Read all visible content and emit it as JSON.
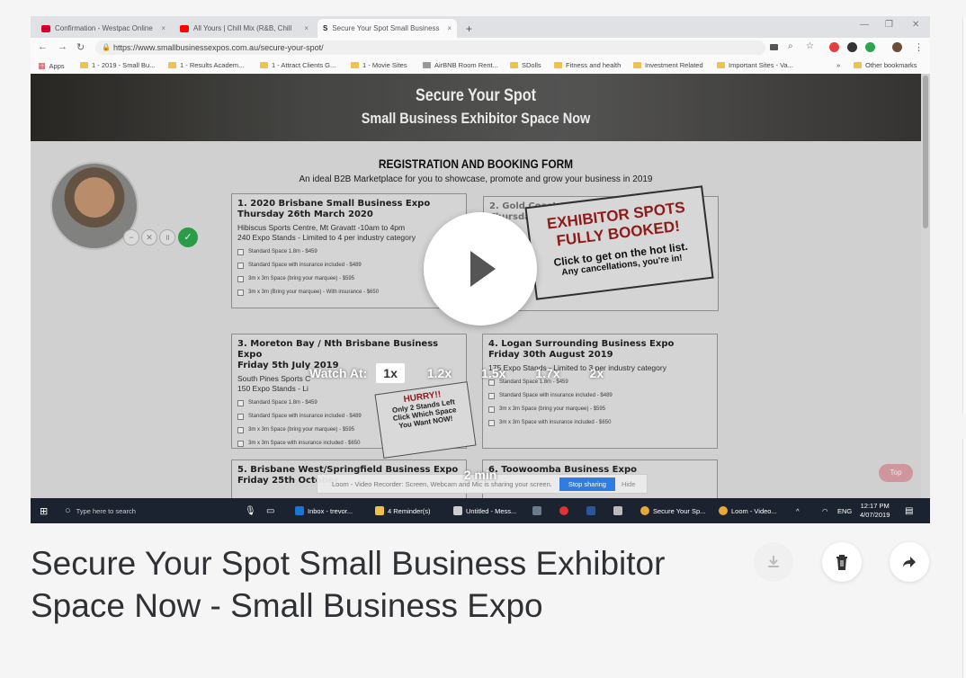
{
  "browser": {
    "tabs": [
      {
        "title": "Confirmation - Westpac Online",
        "favicon_color": "#d5002b"
      },
      {
        "title": "All Yours | Chill Mix (R&B, Chill",
        "favicon_color": "#ff0000"
      },
      {
        "title": "Secure Your Spot Small Business",
        "favicon_color": "#222222"
      }
    ],
    "new_tab": "+",
    "url": "https://www.smallbusinessexpos.com.au/secure-your-spot/",
    "bookmarks": [
      "Apps",
      "1 - 2019 - Small Bu...",
      "1 - Results Academ...",
      "1 - Attract Clients G...",
      "1 - Movie Sites",
      "AirBNB Room Rent...",
      "SDolls",
      "Fitness and health",
      "Investment Related",
      "Important Sites - Va...",
      "»",
      "Other bookmarks"
    ]
  },
  "page": {
    "banner_line1": "Secure Your Spot",
    "banner_line2": "Small Business Exhibitor Space Now",
    "form_title": "REGISTRATION AND BOOKING FORM",
    "form_subtitle": "An ideal B2B Marketplace for you to showcase, promote and grow your business in 2019",
    "cards": [
      {
        "h1": "1. 2020 Brisbane Small Business Expo",
        "h2": "Thursday 26th March 2020",
        "l1": "Hibiscus Sports Centre, Mt Gravatt -10am to 4pm",
        "l2": "240 Expo Stands - Limited to 4 per industry category",
        "opts": [
          "Standard Space 1.8m - $459",
          "Standard Space with insurance included - $489",
          "3m x 3m Space (bring your marquee) - $595",
          "3m x 3m (Bring your marquee) - With insurance - $650"
        ]
      },
      {
        "h1": "2. Gold Coast Small Business Expo",
        "h2": "Thursday 23rd of May 2019",
        "l1": "",
        "l2": "",
        "opts": []
      },
      {
        "h1": "3. Moreton Bay / Nth Brisbane Business Expo",
        "h2": "Friday 5th July 2019",
        "l1": "South Pines Sports C",
        "l2": "150 Expo Stands - Li",
        "opts": [
          "Standard Space 1.8m - $459",
          "Standard Space with insurance included - $489",
          "3m x 3m Space (bring your marquee) - $595",
          "3m x 3m Space with insurance included - $650"
        ]
      },
      {
        "h1": "4. Logan Surrounding Business Expo",
        "h2": "Friday 30th August 2019",
        "l1": "",
        "l2": "175 Expo Stands - Limited to 3 per industry category",
        "opts": [
          "Standard Space 1.8m - $459",
          "Standard Space with insurance included - $489",
          "3m x 3m Space (bring your marquee) - $595",
          "3m x 3m Space with insurance included - $650"
        ]
      },
      {
        "h1": "5. Brisbane West/Springfield Business Expo",
        "h2": "Friday 25th October",
        "l1": "",
        "l2": "",
        "opts": []
      },
      {
        "h1": "6. Toowoomba Business Expo",
        "h2": "",
        "l1": "",
        "l2": "",
        "opts": []
      }
    ],
    "stamp_line1": "EXHIBITOR SPOTS",
    "stamp_line2": "FULLY BOOKED!",
    "stamp_line3": "Click to get on the hot list.",
    "stamp_line4": "Any cancellations, you're in!",
    "hurry_title": "HURRY!!",
    "hurry_l1": "Only 2 Stands Left",
    "hurry_l2": "Click Which Space",
    "hurry_l3": "You Want NOW!",
    "top_button": "Top"
  },
  "player": {
    "watch_at_label": "Watch At:",
    "speeds": [
      "1x",
      "1.2x",
      "1.5x",
      "1.7x",
      "2x"
    ],
    "selected_speed": "1x",
    "duration": "2 min"
  },
  "sharebar": {
    "text": "Loom - Video Recorder: Screen, Webcam and Mic is sharing your screen.",
    "stop": "Stop sharing",
    "hide": "Hide"
  },
  "taskbar": {
    "search": "Type here to search",
    "items": [
      "Inbox - trevor...",
      "4 Reminder(s)",
      "Untitled - Mess...",
      "Secure Your Sp...",
      "Loom - Video..."
    ],
    "lang": "ENG",
    "time": "12:17 PM",
    "date": "4/07/2019"
  },
  "video_title": "Secure Your Spot Small Business Exhibitor Space Now - Small Business Expo",
  "actions": {
    "download": "download-icon",
    "delete": "trash-icon",
    "share": "share-arrow-icon"
  }
}
